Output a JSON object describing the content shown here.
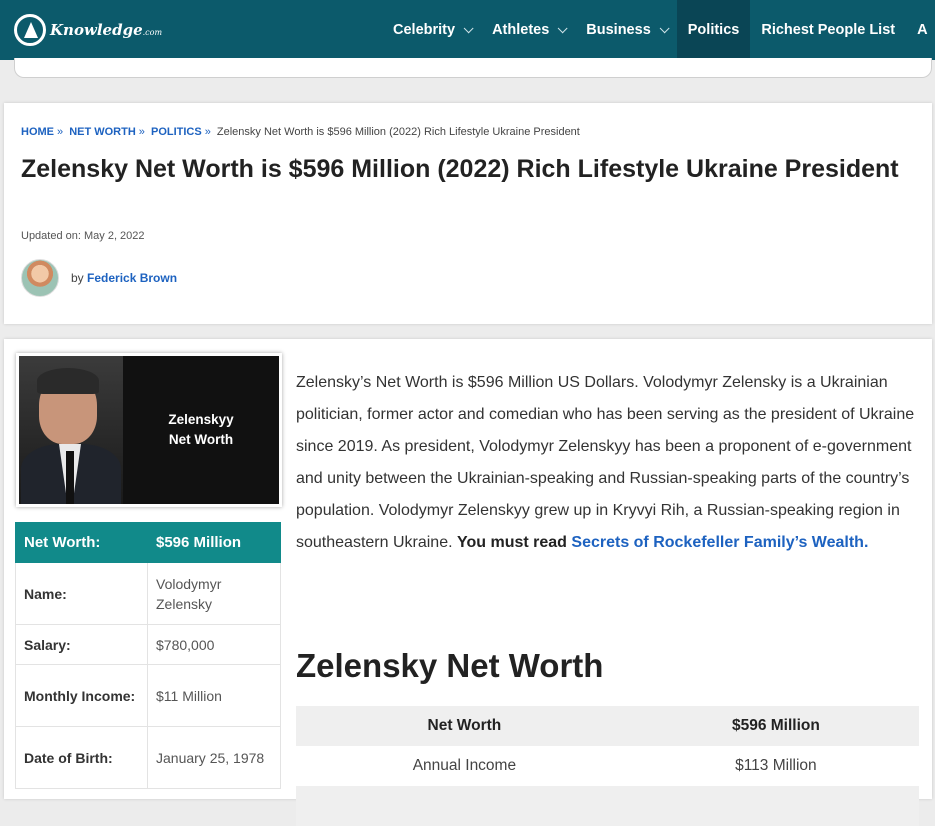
{
  "nav": {
    "logo_text": "Knowledge",
    "logo_suffix": ".com",
    "items": [
      {
        "label": "Celebrity",
        "has_menu": true
      },
      {
        "label": "Athletes",
        "has_menu": true
      },
      {
        "label": "Business",
        "has_menu": true
      },
      {
        "label": "Politics",
        "has_menu": false
      },
      {
        "label": "Richest People List",
        "has_menu": false
      },
      {
        "label": "A",
        "has_menu": false
      }
    ]
  },
  "breadcrumb": {
    "home": "HOME",
    "net_worth": "NET WORTH",
    "politics": "POLITICS",
    "current": "Zelensky Net Worth is $596 Million (2022) Rich Lifestyle Ukraine President",
    "separator": "»"
  },
  "article": {
    "title": "Zelensky Net Worth is $596 Million (2022) Rich Lifestyle Ukraine President",
    "updated": "Updated on: May 2, 2022",
    "by": "by",
    "author": "Federick Brown"
  },
  "photo": {
    "caption_line1": "Zelenskyy",
    "caption_line2": "Net Worth"
  },
  "stats": {
    "header_key": "Net Worth:",
    "header_value": "$596 Million",
    "rows": [
      {
        "key": "Name:",
        "value": "Volodymyr Zelensky"
      },
      {
        "key": "Salary:",
        "value": "$780,000"
      },
      {
        "key": "Monthly Income:",
        "value": "$11 Million"
      },
      {
        "key": "Date of Birth:",
        "value": "January 25, 1978"
      }
    ]
  },
  "body": {
    "paragraph": "Zelensky’s Net Worth is $596 Million US Dollars. Volodymyr Zelensky is a Ukrainian politician, former actor and comedian who has been serving as the president of Ukraine since 2019. As president, Volodymyr Zelenskyy has been a proponent of e-government and unity between the Ukrainian-speaking and Russian-speaking parts of the country’s population. Volodymyr Zelenskyy grew up in Kryvyi Rih, a Russian-speaking region in southeastern Ukraine.",
    "read_prefix": "You must read",
    "read_link": "Secrets of Rockefeller Family’s Wealth.",
    "section_heading": "Zelensky Net Worth"
  },
  "networth_table": {
    "header": [
      "Net Worth",
      "$596 Million"
    ],
    "rows": [
      [
        "Annual Income",
        "$113 Million"
      ]
    ]
  },
  "colors": {
    "nav_bg": "#0c5a6b",
    "nav_active": "#0a4555",
    "accent_teal": "#118a8a",
    "link_blue": "#1d62c0"
  }
}
